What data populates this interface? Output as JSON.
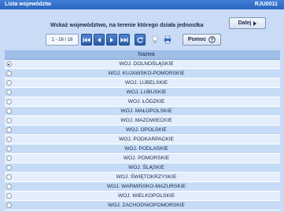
{
  "window": {
    "title": "Lista województw",
    "code": "RJU0011"
  },
  "prompt": "Wskaż województwo, na terenie którego działa jednostka",
  "buttons": {
    "next": "Dalej",
    "help": "Pomoc"
  },
  "pager": {
    "range": "1 - 16 / 16"
  },
  "grid": {
    "header": "Nazwa",
    "rows": [
      "WOJ. DOLNOŚLĄSKIE",
      "WOJ. KUJAWSKO-POMORSKIE",
      "WOJ. LUBELSKIE",
      "WOJ. LUBUSKIE",
      "WOJ. ŁÓDZKIE",
      "WOJ. MAŁOPOLSKIE",
      "WOJ. MAZOWIECKIE",
      "WOJ. OPOLSKIE",
      "WOJ. PODKARPACKIE",
      "WOJ. PODLASKIE",
      "WOJ. POMORSKIE",
      "WOJ. ŚLĄSKIE",
      "WOJ. ŚWIĘTOKRZYSKIE",
      "WOJ. WARMIŃSKO-MAZURSKIE",
      "WOJ. WIELKOPOLSKIE",
      "WOJ. ZACHODNIOPOMORSKIE"
    ],
    "selected_index": 0
  },
  "icons": [
    "first-page-icon",
    "prev-page-icon",
    "next-page-icon",
    "last-page-icon",
    "refresh-icon",
    "bulb-icon",
    "print-icon",
    "help-circle-icon",
    "arrow-right-icon"
  ],
  "colors": {
    "titlebar": "#2b64c0",
    "panel": "#c9dbf5",
    "header": "#9fbee8",
    "row_light": "#e4eefc",
    "row_dark": "#c6dcf6"
  }
}
